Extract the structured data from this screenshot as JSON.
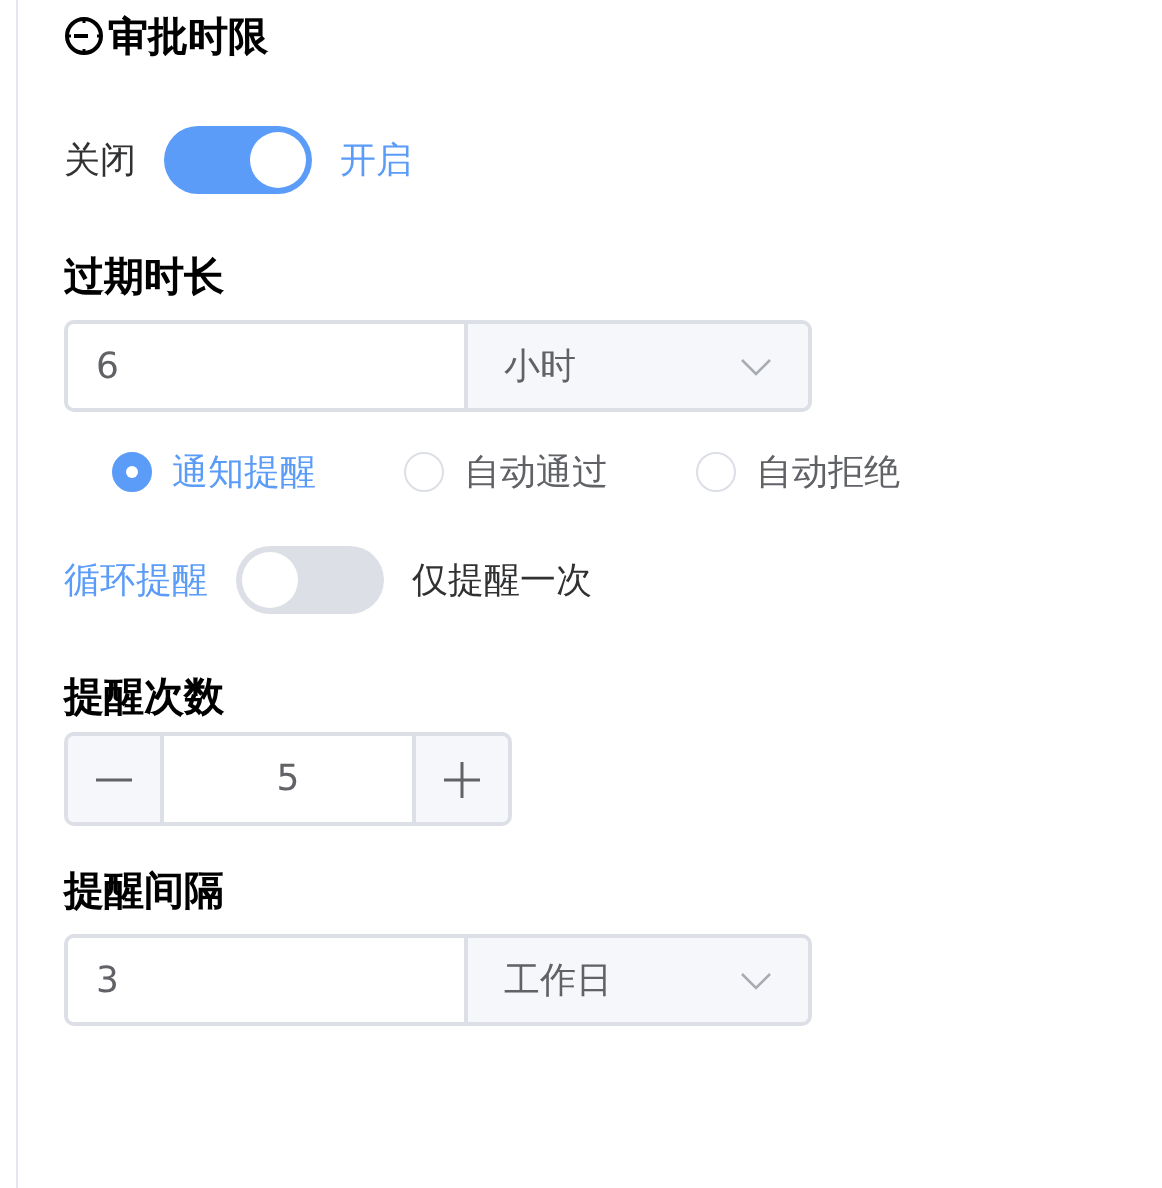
{
  "title": "审批时限",
  "approval_switch": {
    "off_label": "关闭",
    "on_label": "开启",
    "on": true
  },
  "expiry": {
    "label": "过期时长",
    "value": "6",
    "unit": "小时"
  },
  "actions": [
    {
      "label": "通知提醒",
      "selected": true
    },
    {
      "label": "自动通过",
      "selected": false
    },
    {
      "label": "自动拒绝",
      "selected": false
    }
  ],
  "repeat_switch": {
    "off_label": "循环提醒",
    "on_label": "仅提醒一次",
    "on": false
  },
  "count": {
    "label": "提醒次数",
    "value": "5"
  },
  "interval": {
    "label": "提醒间隔",
    "value": "3",
    "unit": "工作日"
  }
}
